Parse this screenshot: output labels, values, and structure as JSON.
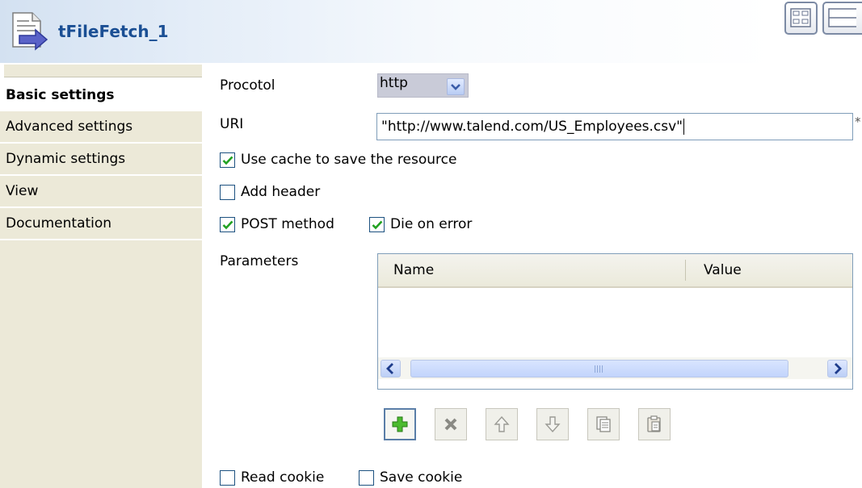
{
  "header": {
    "title": "tFileFetch_1",
    "icon": "file-fetch-icon"
  },
  "sidebar": {
    "tabs": [
      {
        "label": "Basic settings",
        "active": true
      },
      {
        "label": "Advanced settings",
        "active": false
      },
      {
        "label": "Dynamic settings",
        "active": false
      },
      {
        "label": "View",
        "active": false
      },
      {
        "label": "Documentation",
        "active": false
      }
    ]
  },
  "form": {
    "protocol": {
      "label": "Procotol",
      "value": "http"
    },
    "uri": {
      "label": "URI",
      "value": "\"http://www.talend.com/US_Employees.csv\"",
      "required_marker": "*"
    },
    "use_cache": {
      "label": "Use cache to save the resource",
      "checked": true
    },
    "add_header": {
      "label": "Add header",
      "checked": false
    },
    "post_method": {
      "label": "POST method",
      "checked": true
    },
    "die_on_error": {
      "label": "Die on error",
      "checked": true
    },
    "parameters": {
      "label": "Parameters",
      "columns": [
        "Name",
        "Value"
      ],
      "rows": []
    },
    "read_cookie": {
      "label": "Read cookie",
      "checked": false
    },
    "save_cookie": {
      "label": "Save cookie",
      "checked": false
    }
  },
  "toolbar": {
    "buttons": [
      "add-icon",
      "delete-icon",
      "move-up-icon",
      "move-down-icon",
      "copy-icon",
      "paste-icon"
    ]
  },
  "colors": {
    "title": "#1b4f94",
    "tab_background": "#ece9d8",
    "check": "#21a121",
    "checkbox_border": "#1c5180"
  }
}
